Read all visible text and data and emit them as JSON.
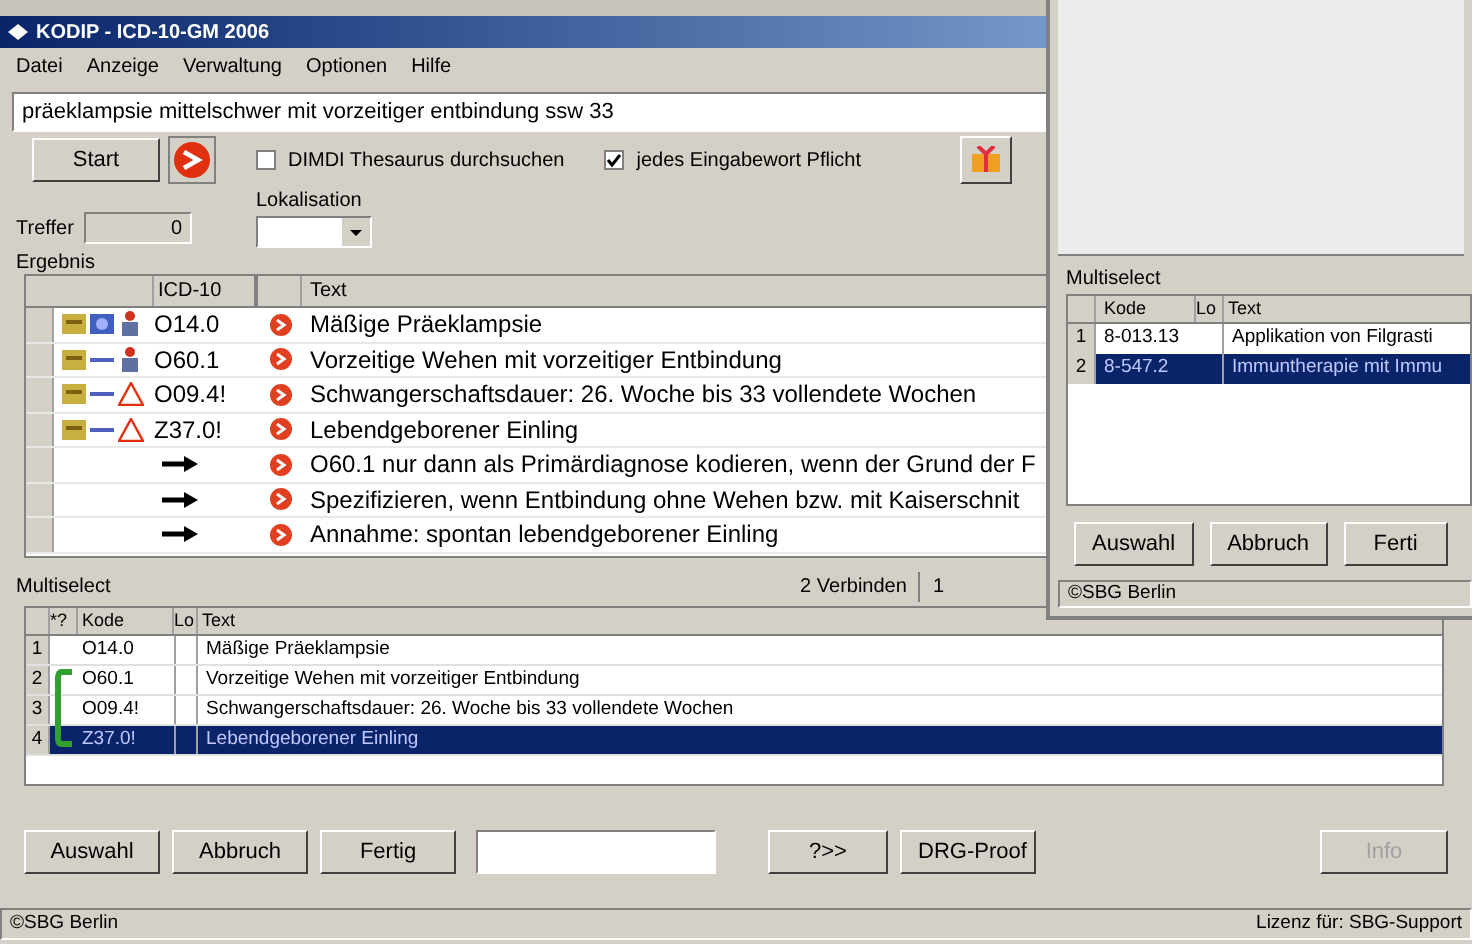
{
  "window": {
    "title": "KODIP - ICD-10-GM 2006"
  },
  "menu": [
    "Datei",
    "Anzeige",
    "Verwaltung",
    "Optionen",
    "Hilfe"
  ],
  "search": {
    "value": "präeklampsie mittelschwer mit vorzeitiger entbindung ssw 33"
  },
  "start_button": "Start",
  "options": [
    {
      "label": "DIMDI Thesaurus durchsuchen",
      "checked": false
    },
    {
      "label": "jedes Eingabewort Pflicht",
      "checked": true
    }
  ],
  "lokalisation": {
    "label": "Lokalisation"
  },
  "treffer": {
    "label": "Treffer",
    "value": "0"
  },
  "result": {
    "label": "Ergebnis",
    "columns": [
      "ICD-10",
      "Text"
    ],
    "rows": [
      {
        "kind": "code",
        "icons": [
          {
            "kind": "book"
          },
          {
            "kind": "badge"
          },
          {
            "kind": "figure"
          }
        ],
        "code": "O14.0",
        "text": "Mäßige Präeklampsie"
      },
      {
        "kind": "code",
        "icons": [
          {
            "kind": "book"
          },
          {
            "kind": "dash"
          },
          {
            "kind": "figure"
          }
        ],
        "code": "O60.1",
        "text": "Vorzeitige Wehen mit vorzeitiger Entbindung"
      },
      {
        "kind": "code",
        "icons": [
          {
            "kind": "book"
          },
          {
            "kind": "dash"
          },
          {
            "kind": "warning"
          }
        ],
        "code": "O09.4!",
        "text": "Schwangerschaftsdauer: 26. Woche bis 33 vollendete Wochen"
      },
      {
        "kind": "code",
        "icons": [
          {
            "kind": "book"
          },
          {
            "kind": "dash"
          },
          {
            "kind": "warning"
          }
        ],
        "code": "Z37.0!",
        "text": "Lebendgeborener Einling"
      },
      {
        "kind": "note",
        "text": "O60.1 nur dann als Primärdiagnose kodieren, wenn der Grund der F"
      },
      {
        "kind": "note",
        "text": "Spezifizieren, wenn Entbindung ohne Wehen bzw. mit Kaiserschnit"
      },
      {
        "kind": "note",
        "text": "Annahme: spontan lebendgeborener Einling"
      }
    ]
  },
  "multiselect": {
    "label": "Multiselect",
    "connect": "2 Verbinden",
    "count": "1",
    "columns": [
      "*?",
      "Kode",
      "Lo",
      "Text"
    ],
    "rows": [
      {
        "num": "1",
        "code": "O14.0",
        "text": "Mäßige Präeklampsie",
        "selected": false
      },
      {
        "num": "2",
        "code": "O60.1",
        "text": "Vorzeitige Wehen mit vorzeitiger Entbindung",
        "selected": false
      },
      {
        "num": "3",
        "code": "O09.4!",
        "text": "Schwangerschaftsdauer: 26. Woche bis 33 vollendete Wochen",
        "selected": false
      },
      {
        "num": "4",
        "code": "Z37.0!",
        "text": "Lebendgeborener Einling",
        "selected": true
      }
    ]
  },
  "buttons": [
    {
      "label": "Auswahl",
      "disabled": false
    },
    {
      "label": "Abbruch",
      "disabled": false
    },
    {
      "label": "Fertig",
      "disabled": false
    }
  ],
  "extra_buttons": [
    {
      "label": "?>>",
      "disabled": false
    },
    {
      "label": "DRG-Proof",
      "disabled": false
    },
    {
      "label": "Info",
      "disabled": true
    }
  ],
  "status_bar": {
    "left": "©SBG Berlin",
    "right": "Lizenz für: SBG-Support"
  },
  "second_window": {
    "label": "Multiselect",
    "columns": [
      "Kode",
      "Lo",
      "Text"
    ],
    "rows": [
      {
        "num": "1",
        "code": "8-013.13",
        "text": "Applikation von Filgrasti",
        "selected": false
      },
      {
        "num": "2",
        "code": "8-547.2",
        "text": "Immuntherapie mit Immu",
        "selected": true
      }
    ],
    "buttons": [
      "Auswahl",
      "Abbruch",
      "Ferti"
    ],
    "status": "©SBG Berlin"
  }
}
